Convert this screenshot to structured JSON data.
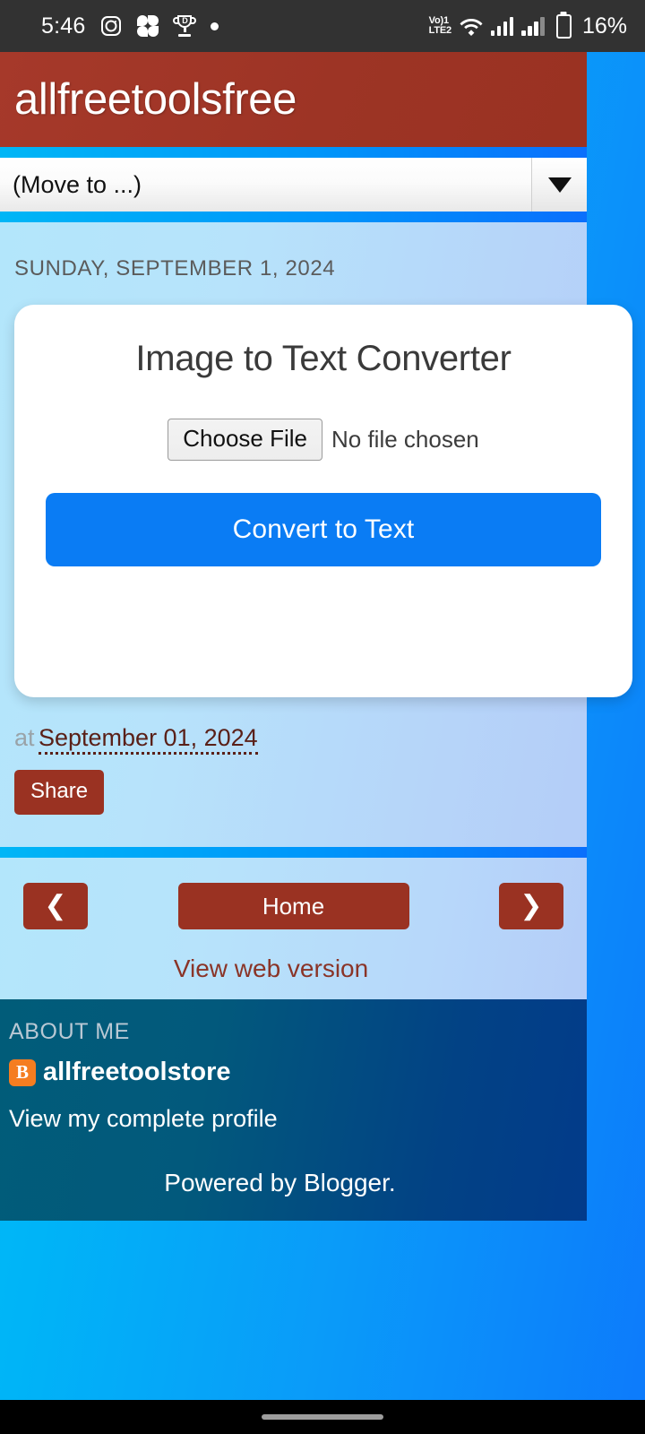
{
  "statusbar": {
    "clock": "5:46",
    "icons_left": [
      "instagram-icon",
      "clover-icon",
      "trophy-icon",
      "dot-icon"
    ],
    "volte_top": "Vo)1",
    "volte_bottom": "LTE2",
    "icons_right": [
      "volte-icon",
      "wifi-icon",
      "signal-bars-1-icon",
      "signal-bars-2-icon",
      "battery-icon"
    ],
    "battery_percent": "16%"
  },
  "blog": {
    "title": "allfreetoolsfree",
    "accent_red": "#9a3222",
    "accent_blue": "#0a7cf4"
  },
  "navigate_select": {
    "selected": "(Move to ...)",
    "caret": "chevron-down-icon"
  },
  "post": {
    "date_header": "SUNDAY, SEPTEMBER 1, 2024",
    "meta_prefix": "at",
    "meta_date": "September 01, 2024",
    "share_label": "Share"
  },
  "tool": {
    "title": "Image to Text Converter",
    "choose_file_label": "Choose File",
    "file_status": "No file chosen",
    "convert_label": "Convert to Text"
  },
  "navigation": {
    "prev": "❮",
    "home": "Home",
    "next": "❯",
    "web_version": "View web version"
  },
  "about": {
    "heading": "ABOUT ME",
    "blogger_glyph": "B",
    "username": "allfreetoolstore",
    "profile_link": "View my complete profile",
    "powered_by": "Powered by Blogger."
  }
}
